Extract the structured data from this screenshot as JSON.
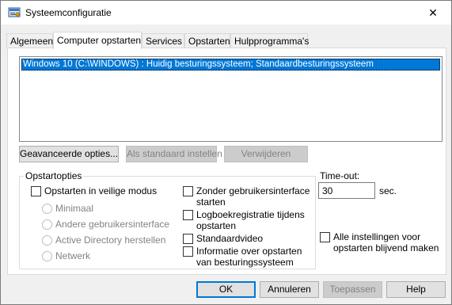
{
  "window": {
    "title": "Systeemconfiguratie",
    "icon": "msconfig-icon",
    "close_glyph": "✕"
  },
  "tabs": [
    {
      "label": "Algemeen",
      "active": false
    },
    {
      "label": "Computer opstarten",
      "active": true
    },
    {
      "label": "Services",
      "active": false
    },
    {
      "label": "Opstarten",
      "active": false
    },
    {
      "label": "Hulpprogramma's",
      "active": false
    }
  ],
  "boot_list": {
    "items": [
      "Windows 10 (C:\\WINDOWS) : Huidig besturingssysteem; Standaardbesturingssysteem"
    ],
    "selected_color": "#0078d7"
  },
  "boot_buttons": {
    "advanced": "Geavanceerde opties...",
    "set_default": "Als standaard instellen",
    "delete": "Verwijderen"
  },
  "boot_options": {
    "legend": "Opstartopties",
    "safe_boot": "Opstarten in veilige modus",
    "radios": [
      "Minimaal",
      "Andere gebruikersinterface",
      "Active Directory herstellen",
      "Netwerk"
    ],
    "no_gui_line1": "Zonder gebruikersinterface",
    "no_gui_line2": "starten",
    "boot_log_line1": "Logboekregistratie tijdens",
    "boot_log_line2": "opstarten",
    "base_video": "Standaardvideo",
    "os_info_line1": "Informatie over opstarten",
    "os_info_line2": "van besturingssysteem"
  },
  "timeout": {
    "label": "Time-out:",
    "value": "30",
    "unit": "sec."
  },
  "make_permanent": {
    "line1": "Alle instellingen voor",
    "line2": "opstarten blijvend maken"
  },
  "dialog_buttons": {
    "ok": "OK",
    "cancel": "Annuleren",
    "apply": "Toepassen",
    "help": "Help"
  }
}
